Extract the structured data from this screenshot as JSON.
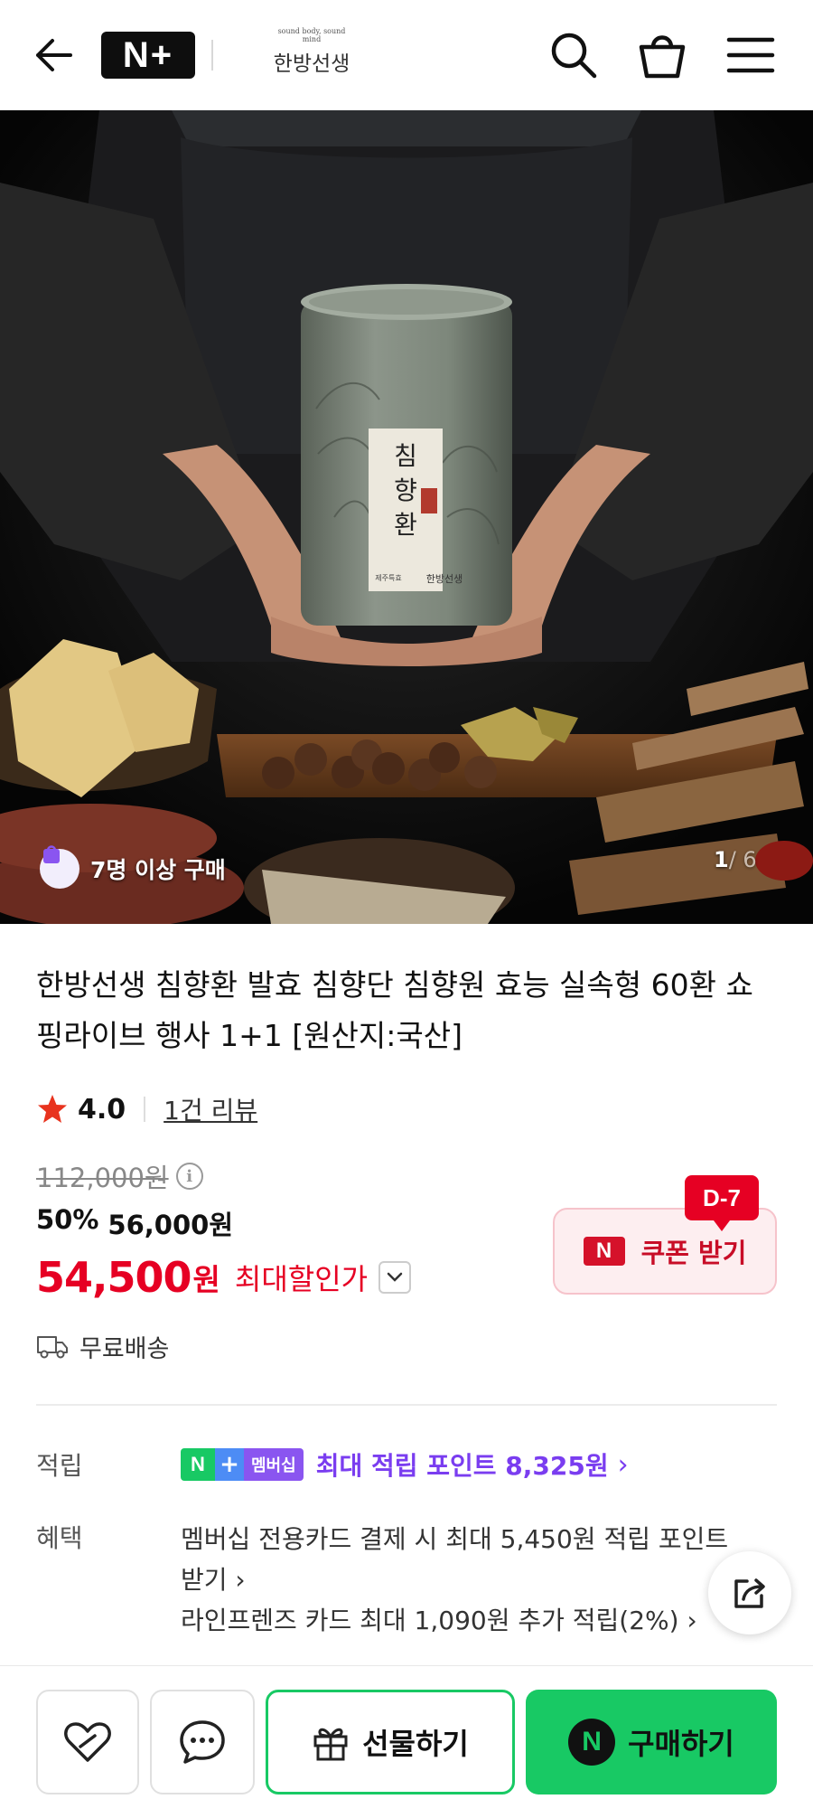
{
  "header": {
    "back_icon": "arrow-left-icon",
    "nplus_logo": "N+",
    "brand_small": "sound body, sound mind",
    "brand_name": "한방선생",
    "search_icon": "search-icon",
    "cart_icon": "shopping-bag-icon",
    "menu_icon": "hamburger-menu-icon"
  },
  "hero": {
    "badge_icon": "shopping-bag-icon",
    "badge_text": "7명 이상 구매",
    "counter_current": "1",
    "counter_rest": "/ 6",
    "product_label_vertical": [
      "침",
      "향",
      "환"
    ],
    "product_brand_text": "한방선생",
    "product_small_text": "제주특효"
  },
  "product": {
    "title": "한방선생 침향환 발효 침향단 침향원 효능 실속형 60환 쇼핑라이브 행사 1+1 [원산지:국산]",
    "rating": "4.0",
    "review_link": "1건 리뷰",
    "original_price": "112,000원",
    "discount_percent": "50%",
    "sale_price": "56,000원",
    "final_amount": "54,500",
    "final_unit": "원",
    "final_label": "최대할인가",
    "coupon_logo": "N",
    "coupon_label": "쿠폰 받기",
    "coupon_badge": "D-7",
    "shipping_label": "무료배송"
  },
  "points": {
    "label": "적립",
    "badge_n": "N",
    "badge_plus": "+",
    "badge_text": "멤버십",
    "text": "최대 적립 포인트 8,325원",
    "chevron": "›"
  },
  "benefits": {
    "label": "혜택",
    "line1": "멤버십 전용카드 결제 시 최대 5,450원 적립 포인트",
    "line2": "받기 ›",
    "line3": "라인프렌즈 카드 최대 1,090원 추가 적립(2%) ›"
  },
  "bottom_bar": {
    "wishlist_icon": "heart-icon",
    "chat_icon": "chat-bubble-icon",
    "gift_label": "선물하기",
    "buy_logo": "N",
    "buy_label": "구매하기"
  },
  "colors": {
    "sale_red": "#e60023",
    "naver_green": "#18c964",
    "membership_purple": "#7a3df0",
    "coupon_bg": "#fdeef0"
  }
}
